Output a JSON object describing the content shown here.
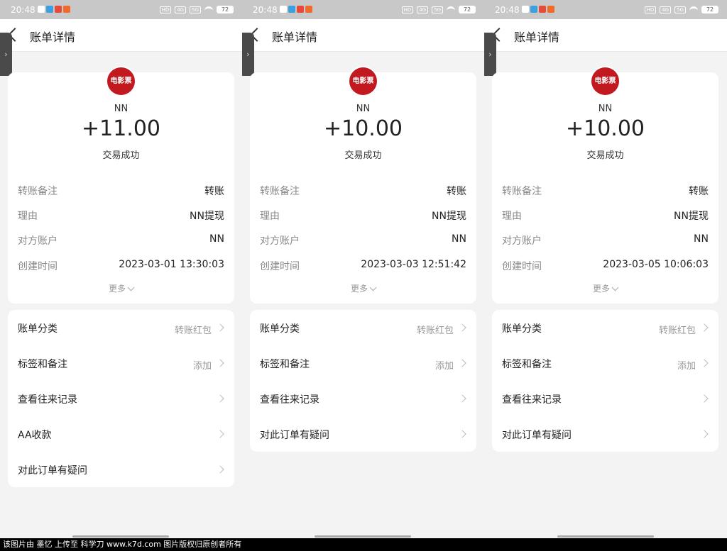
{
  "status_bar": {
    "time": "20:48",
    "chips": [
      "HD",
      "4G",
      "5G"
    ],
    "battery": "72"
  },
  "nav": {
    "title": "账单详情"
  },
  "detail_labels": {
    "remark": "转账备注",
    "reason": "理由",
    "account": "对方账户",
    "time": "创建时间"
  },
  "more_label": "更多",
  "colors": {
    "logo_red": "#c2181f",
    "background": "#f3f3f3",
    "status_bar": "#c8c8c8"
  },
  "screens": [
    {
      "logo_text": "电影票",
      "merchant": "NN",
      "amount": "+11.00",
      "status": "交易成功",
      "details": {
        "remark": "转账",
        "reason": "NN提现",
        "account": "NN",
        "time": "2023-03-01 13:30:03"
      },
      "menu": [
        {
          "label": "账单分类",
          "value": "转账红包"
        },
        {
          "label": "标签和备注",
          "value": "添加"
        },
        {
          "label": "查看往来记录",
          "value": ""
        },
        {
          "label": "AA收款",
          "value": ""
        },
        {
          "label": "对此订单有疑问",
          "value": ""
        }
      ]
    },
    {
      "logo_text": "电影票",
      "merchant": "NN",
      "amount": "+10.00",
      "status": "交易成功",
      "details": {
        "remark": "转账",
        "reason": "NN提现",
        "account": "NN",
        "time": "2023-03-03 12:51:42"
      },
      "menu": [
        {
          "label": "账单分类",
          "value": "转账红包"
        },
        {
          "label": "标签和备注",
          "value": "添加"
        },
        {
          "label": "查看往来记录",
          "value": ""
        },
        {
          "label": "对此订单有疑问",
          "value": ""
        }
      ]
    },
    {
      "logo_text": "电影票",
      "merchant": "NN",
      "amount": "+10.00",
      "status": "交易成功",
      "details": {
        "remark": "转账",
        "reason": "NN提现",
        "account": "NN",
        "time": "2023-03-05 10:06:03"
      },
      "menu": [
        {
          "label": "账单分类",
          "value": "转账红包"
        },
        {
          "label": "标签和备注",
          "value": "添加"
        },
        {
          "label": "查看往来记录",
          "value": ""
        },
        {
          "label": "对此订单有疑问",
          "value": ""
        }
      ]
    }
  ],
  "footer_text": "该图片由 墨忆 上传至 科学刀 www.k7d.com 图片版权归原创者所有"
}
